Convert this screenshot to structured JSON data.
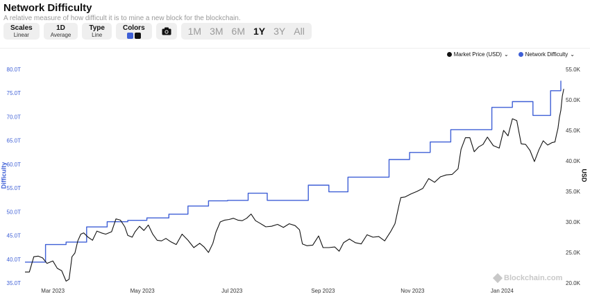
{
  "header": {
    "title": "Network Difficulty",
    "subtitle": "A relative measure of how difficult it is to mine a new block for the blockchain."
  },
  "controls": [
    {
      "title": "Scales",
      "value": "Linear"
    },
    {
      "title": "1D",
      "value": "Average"
    },
    {
      "title": "Type",
      "value": "Line"
    }
  ],
  "colors_control": {
    "title": "Colors",
    "swatches": [
      "#3e5fd6",
      "#111111"
    ]
  },
  "camera_icon": "camera-icon",
  "ranges": [
    "1M",
    "3M",
    "6M",
    "1Y",
    "3Y",
    "All"
  ],
  "active_range": "1Y",
  "legend": [
    {
      "label": "Market Price (USD)",
      "color": "#111111"
    },
    {
      "label": "Network Difficulty",
      "color": "#3e5fd6"
    }
  ],
  "watermark": "Blockchain.com",
  "chart_data": {
    "type": "line",
    "xlabel": "",
    "x_ticks": [
      "Mar 2023",
      "May 2023",
      "Jul 2023",
      "Sep 2023",
      "Nov 2023",
      "Jan 2024"
    ],
    "x_range": [
      "2023-02-10",
      "2024-02-10"
    ],
    "y_left": {
      "label": "Difficulty",
      "ticks": [
        "35.0T",
        "40.0T",
        "45.0T",
        "50.0T",
        "55.0T",
        "60.0T",
        "65.0T",
        "70.0T",
        "75.0T",
        "80.0T"
      ],
      "range": [
        35,
        80
      ]
    },
    "y_right": {
      "label": "USD",
      "ticks": [
        "20.0K",
        "25.0K",
        "30.0K",
        "35.0K",
        "40.0K",
        "45.0K",
        "50.0K",
        "55.0K"
      ],
      "range": [
        20,
        55
      ]
    },
    "series": [
      {
        "name": "Network Difficulty",
        "axis": "left",
        "unit": "T",
        "color": "#3e5fd6",
        "step": true,
        "points": [
          [
            "2023-02-10",
            39.4
          ],
          [
            "2023-02-24",
            43.1
          ],
          [
            "2023-03-10",
            43.6
          ],
          [
            "2023-03-24",
            46.8
          ],
          [
            "2023-04-07",
            47.9
          ],
          [
            "2023-04-21",
            48.2
          ],
          [
            "2023-05-04",
            48.7
          ],
          [
            "2023-05-19",
            49.5
          ],
          [
            "2023-06-01",
            51.2
          ],
          [
            "2023-06-15",
            52.3
          ],
          [
            "2023-06-28",
            52.4
          ],
          [
            "2023-07-12",
            53.9
          ],
          [
            "2023-07-25",
            52.4
          ],
          [
            "2023-08-08",
            52.4
          ],
          [
            "2023-08-22",
            55.6
          ],
          [
            "2023-09-05",
            54.2
          ],
          [
            "2023-09-18",
            57.3
          ],
          [
            "2023-10-02",
            57.3
          ],
          [
            "2023-10-16",
            61.0
          ],
          [
            "2023-10-30",
            62.5
          ],
          [
            "2023-11-13",
            64.7
          ],
          [
            "2023-11-27",
            67.3
          ],
          [
            "2023-12-11",
            67.3
          ],
          [
            "2023-12-25",
            72.0
          ],
          [
            "2024-01-08",
            73.2
          ],
          [
            "2024-01-22",
            70.3
          ],
          [
            "2024-02-03",
            75.5
          ],
          [
            "2024-02-10",
            75.5
          ],
          [
            "2024-02-10",
            77.6
          ]
        ]
      },
      {
        "name": "Market Price (USD)",
        "axis": "right",
        "unit": "K",
        "color": "#111111",
        "step": false,
        "points": [
          [
            "2023-02-10",
            21.8
          ],
          [
            "2023-02-13",
            21.8
          ],
          [
            "2023-02-16",
            24.3
          ],
          [
            "2023-02-19",
            24.4
          ],
          [
            "2023-02-22",
            24.1
          ],
          [
            "2023-02-25",
            23.2
          ],
          [
            "2023-03-01",
            23.6
          ],
          [
            "2023-03-04",
            22.4
          ],
          [
            "2023-03-07",
            22.0
          ],
          [
            "2023-03-10",
            20.3
          ],
          [
            "2023-03-12",
            20.6
          ],
          [
            "2023-03-14",
            24.3
          ],
          [
            "2023-03-16",
            24.9
          ],
          [
            "2023-03-18",
            26.9
          ],
          [
            "2023-03-20",
            28.0
          ],
          [
            "2023-03-22",
            28.2
          ],
          [
            "2023-03-25",
            27.5
          ],
          [
            "2023-03-28",
            27.0
          ],
          [
            "2023-03-31",
            28.5
          ],
          [
            "2023-04-03",
            28.2
          ],
          [
            "2023-04-06",
            28.0
          ],
          [
            "2023-04-10",
            28.4
          ],
          [
            "2023-04-13",
            30.5
          ],
          [
            "2023-04-16",
            30.3
          ],
          [
            "2023-04-19",
            29.2
          ],
          [
            "2023-04-21",
            27.8
          ],
          [
            "2023-04-24",
            27.5
          ],
          [
            "2023-04-26",
            28.4
          ],
          [
            "2023-04-29",
            29.3
          ],
          [
            "2023-05-02",
            28.6
          ],
          [
            "2023-05-05",
            29.5
          ],
          [
            "2023-05-08",
            28.0
          ],
          [
            "2023-05-11",
            27.0
          ],
          [
            "2023-05-14",
            26.9
          ],
          [
            "2023-05-17",
            27.3
          ],
          [
            "2023-05-20",
            26.8
          ],
          [
            "2023-05-24",
            26.3
          ],
          [
            "2023-05-28",
            28.0
          ],
          [
            "2023-06-01",
            27.0
          ],
          [
            "2023-06-05",
            25.8
          ],
          [
            "2023-06-09",
            26.5
          ],
          [
            "2023-06-12",
            25.9
          ],
          [
            "2023-06-15",
            25.0
          ],
          [
            "2023-06-18",
            26.5
          ],
          [
            "2023-06-20",
            28.3
          ],
          [
            "2023-06-23",
            30.0
          ],
          [
            "2023-06-26",
            30.3
          ],
          [
            "2023-06-29",
            30.4
          ],
          [
            "2023-07-02",
            30.6
          ],
          [
            "2023-07-05",
            30.3
          ],
          [
            "2023-07-08",
            30.2
          ],
          [
            "2023-07-11",
            30.6
          ],
          [
            "2023-07-14",
            31.3
          ],
          [
            "2023-07-17",
            30.2
          ],
          [
            "2023-07-20",
            29.8
          ],
          [
            "2023-07-24",
            29.2
          ],
          [
            "2023-07-28",
            29.3
          ],
          [
            "2023-08-01",
            29.6
          ],
          [
            "2023-08-05",
            29.1
          ],
          [
            "2023-08-09",
            29.7
          ],
          [
            "2023-08-13",
            29.4
          ],
          [
            "2023-08-16",
            28.7
          ],
          [
            "2023-08-18",
            26.4
          ],
          [
            "2023-08-21",
            26.1
          ],
          [
            "2023-08-25",
            26.2
          ],
          [
            "2023-08-29",
            27.7
          ],
          [
            "2023-09-01",
            25.8
          ],
          [
            "2023-09-05",
            25.8
          ],
          [
            "2023-09-09",
            25.9
          ],
          [
            "2023-09-12",
            25.2
          ],
          [
            "2023-09-15",
            26.6
          ],
          [
            "2023-09-19",
            27.2
          ],
          [
            "2023-09-23",
            26.6
          ],
          [
            "2023-09-27",
            26.4
          ],
          [
            "2023-10-01",
            27.9
          ],
          [
            "2023-10-05",
            27.5
          ],
          [
            "2023-10-09",
            27.6
          ],
          [
            "2023-10-13",
            26.9
          ],
          [
            "2023-10-17",
            28.4
          ],
          [
            "2023-10-20",
            29.7
          ],
          [
            "2023-10-23",
            33.0
          ],
          [
            "2023-10-24",
            34.0
          ],
          [
            "2023-10-27",
            34.1
          ],
          [
            "2023-10-31",
            34.6
          ],
          [
            "2023-11-04",
            35.0
          ],
          [
            "2023-11-08",
            35.5
          ],
          [
            "2023-11-12",
            37.1
          ],
          [
            "2023-11-16",
            36.5
          ],
          [
            "2023-11-20",
            37.4
          ],
          [
            "2023-11-24",
            37.7
          ],
          [
            "2023-11-28",
            37.8
          ],
          [
            "2023-12-02",
            38.7
          ],
          [
            "2023-12-04",
            41.9
          ],
          [
            "2023-12-07",
            43.8
          ],
          [
            "2023-12-10",
            43.8
          ],
          [
            "2023-12-13",
            41.5
          ],
          [
            "2023-12-16",
            42.3
          ],
          [
            "2023-12-19",
            42.7
          ],
          [
            "2023-12-22",
            43.9
          ],
          [
            "2023-12-26",
            42.5
          ],
          [
            "2023-12-30",
            42.1
          ],
          [
            "2024-01-02",
            45.0
          ],
          [
            "2024-01-05",
            44.1
          ],
          [
            "2024-01-08",
            46.9
          ],
          [
            "2024-01-11",
            46.6
          ],
          [
            "2024-01-14",
            42.8
          ],
          [
            "2024-01-17",
            42.7
          ],
          [
            "2024-01-20",
            41.7
          ],
          [
            "2024-01-23",
            39.9
          ],
          [
            "2024-01-26",
            41.8
          ],
          [
            "2024-01-29",
            43.3
          ],
          [
            "2024-02-01",
            42.6
          ],
          [
            "2024-02-04",
            43.0
          ],
          [
            "2024-02-06",
            43.1
          ],
          [
            "2024-02-07",
            44.3
          ],
          [
            "2024-02-08",
            45.3
          ],
          [
            "2024-02-09",
            47.1
          ],
          [
            "2024-02-10",
            48.3
          ],
          [
            "2024-02-11",
            50.6
          ],
          [
            "2024-02-12",
            51.8
          ]
        ]
      }
    ],
    "legend_position": "top-right",
    "grid": false
  }
}
